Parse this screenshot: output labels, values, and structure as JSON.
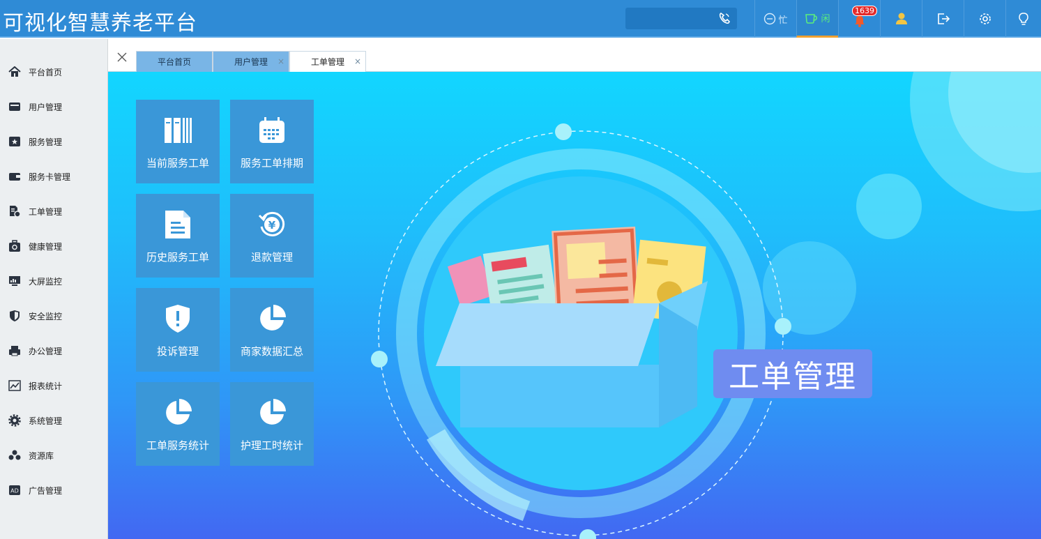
{
  "app": {
    "title": "可视化智慧养老平台"
  },
  "header": {
    "search": {
      "value": "",
      "placeholder": ""
    },
    "phone_icon": "phone-icon",
    "status_busy": "忙",
    "status_idle": "闲",
    "notification_count": "1639",
    "icons": [
      "busy-icon",
      "idle-cup-icon",
      "bell-icon",
      "user-icon",
      "logout-icon",
      "settings-icon",
      "lightbulb-icon"
    ],
    "active_accent": "#f0a030"
  },
  "sidebar": {
    "items": [
      {
        "label": "平台首页",
        "icon": "home-icon"
      },
      {
        "label": "用户管理",
        "icon": "inbox-icon"
      },
      {
        "label": "服务管理",
        "icon": "star-card-icon"
      },
      {
        "label": "服务卡管理",
        "icon": "wallet-icon"
      },
      {
        "label": "工单管理",
        "icon": "document-gear-icon"
      },
      {
        "label": "健康管理",
        "icon": "medical-kit-icon"
      },
      {
        "label": "大屏监控",
        "icon": "monitor-icon"
      },
      {
        "label": "安全监控",
        "icon": "shield-icon"
      },
      {
        "label": "办公管理",
        "icon": "printer-icon"
      },
      {
        "label": "报表统计",
        "icon": "chart-icon"
      },
      {
        "label": "系统管理",
        "icon": "gear-icon"
      },
      {
        "label": "资源库",
        "icon": "cluster-icon"
      },
      {
        "label": "广告管理",
        "icon": "ad-icon"
      }
    ]
  },
  "tabs": [
    {
      "label": "平台首页",
      "closable": false,
      "active": false
    },
    {
      "label": "用户管理",
      "closable": true,
      "active": false
    },
    {
      "label": "工单管理",
      "closable": true,
      "active": true
    }
  ],
  "tab_close": "×",
  "tiles": [
    {
      "label": "当前服务工单",
      "icon": "binders-icon"
    },
    {
      "label": "服务工单排期",
      "icon": "calendar-icon"
    },
    {
      "label": "历史服务工单",
      "icon": "document-icon"
    },
    {
      "label": "退款管理",
      "icon": "refund-yen-icon"
    },
    {
      "label": "投诉管理",
      "icon": "shield-alert-icon"
    },
    {
      "label": "商家数据汇总",
      "icon": "pie-chart-icon"
    },
    {
      "label": "工单服务统计",
      "icon": "pie-chart-icon"
    },
    {
      "label": "护理工时统计",
      "icon": "pie-chart-icon"
    }
  ],
  "banner": {
    "label": "工单管理"
  },
  "colors": {
    "header_bg": "#2f8bd6",
    "tile_bg": "#3a97d8",
    "banner_bg": "#6f8cf0",
    "badge_bg": "#e52b2b"
  }
}
